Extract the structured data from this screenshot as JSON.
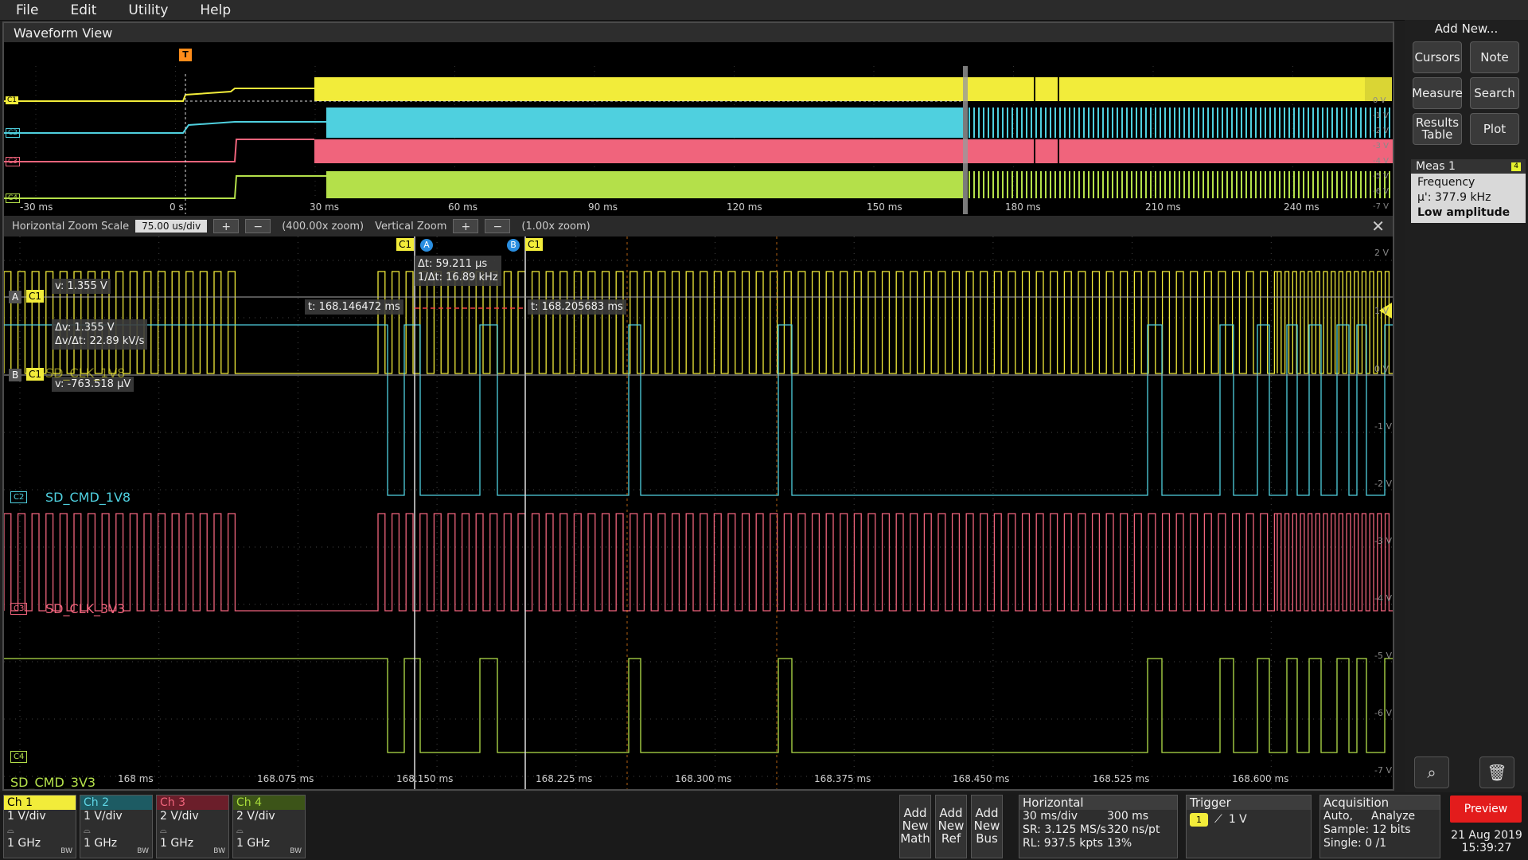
{
  "menu": [
    "File",
    "Edit",
    "Utility",
    "Help"
  ],
  "waveform_view": {
    "title": "Waveform View",
    "overview_ticks": [
      "-30 ms",
      "0 s",
      "30 ms",
      "60 ms",
      "90 ms",
      "120 ms",
      "150 ms",
      "180 ms",
      "210 ms",
      "240 ms"
    ],
    "overview_volts": [
      "0 V",
      "-1 V",
      "-2 V",
      "-3 V",
      "-4 V",
      "-5 V",
      "-6 V",
      "-7 V"
    ],
    "trigger_marker": "T",
    "zoom": {
      "hscale_label": "Horizontal Zoom Scale",
      "hscale_value": "75.00 us/div",
      "hzoom": "(400.00x zoom)",
      "vlabel": "Vertical Zoom",
      "vzoom": "(1.00x zoom)",
      "plus": "+",
      "minus": "−",
      "close": "✕"
    },
    "time_ticks": [
      "168 ms",
      "168.075 ms",
      "168.150 ms",
      "168.225 ms",
      "168.300 ms",
      "168.375 ms",
      "168.450 ms",
      "168.525 ms",
      "168.600 ms"
    ],
    "volt_ticks": [
      "2 V",
      "1 V",
      "0 V",
      "-1 V",
      "-2 V",
      "-3 V",
      "-4 V",
      "-5 V",
      "-6 V",
      "-7 V"
    ],
    "channel_names": {
      "c2": "SD_CMD_1V8",
      "c3": "SD_CLK_3V3",
      "c4": "SD_CMD_3V3",
      "c1": "SD_CLK_1V8"
    },
    "channel_tags": {
      "c1": "C1",
      "c2": "C2",
      "c3": "C3",
      "c4": "C4"
    },
    "cursors": {
      "a_tag": "A",
      "b_tag": "B",
      "a_v": "v: 1.355 V",
      "b_v": "v: -763.518 µV",
      "dv": "Δv: 1.355 V",
      "dvdt": "Δv/Δt: 22.89 kV/s",
      "dt": "Δt: 59.211 µs",
      "inv_dt": "1/Δt: 16.89 kHz",
      "t_a": "t: 168.146472 ms",
      "t_b": "t: 168.205683 ms"
    }
  },
  "right_panel": {
    "add_new": "Add New...",
    "buttons": [
      "Cursors",
      "Note",
      "Measure",
      "Search",
      "Results Table",
      "Plot"
    ],
    "meas": {
      "title": "Meas 1",
      "badge": "4",
      "name": "Frequency",
      "value": "µ': 377.9 kHz",
      "note": "Low amplitude"
    }
  },
  "bottom": {
    "channels": [
      {
        "name": "Ch 1",
        "vdiv": "1 V/div",
        "bw": "1 GHz",
        "bw_icon": "BW",
        "color": "#f2ec3a",
        "text": "#000"
      },
      {
        "name": "Ch 2",
        "vdiv": "1 V/div",
        "bw": "1 GHz",
        "bw_icon": "BW",
        "color": "#1d5b63",
        "text": "#5fd7e6"
      },
      {
        "name": "Ch 3",
        "vdiv": "2 V/div",
        "bw": "1 GHz",
        "bw_icon": "BW",
        "color": "#6b1e2a",
        "text": "#f0647c"
      },
      {
        "name": "Ch 4",
        "vdiv": "2 V/div",
        "bw": "1 GHz",
        "bw_icon": "BW",
        "color": "#3c5418",
        "text": "#a9dc3a"
      }
    ],
    "add_math": "Add New Math",
    "add_ref": "Add New Ref",
    "add_bus": "Add New Bus",
    "horizontal": {
      "title": "Horizontal",
      "scale": "30 ms/div",
      "pos": "300 ms",
      "sr": "SR: 3.125 MS/s",
      "res": "320 ns/pt",
      "rl": "RL: 937.5 kpts",
      "pct": "13%"
    },
    "trigger": {
      "title": "Trigger",
      "src": "1",
      "level": "1 V"
    },
    "acquisition": {
      "title": "Acquisition",
      "mode": "Auto,",
      "analyze": "Analyze",
      "sample": "Sample: 12 bits",
      "single": "Single: 0 /1"
    },
    "preview": "Preview",
    "date": "21 Aug 2019",
    "time": "15:39:27"
  },
  "colors": {
    "c1": "#f2ec3a",
    "c2": "#4fd0df",
    "c3": "#f0647c",
    "c4": "#b4e04a"
  }
}
